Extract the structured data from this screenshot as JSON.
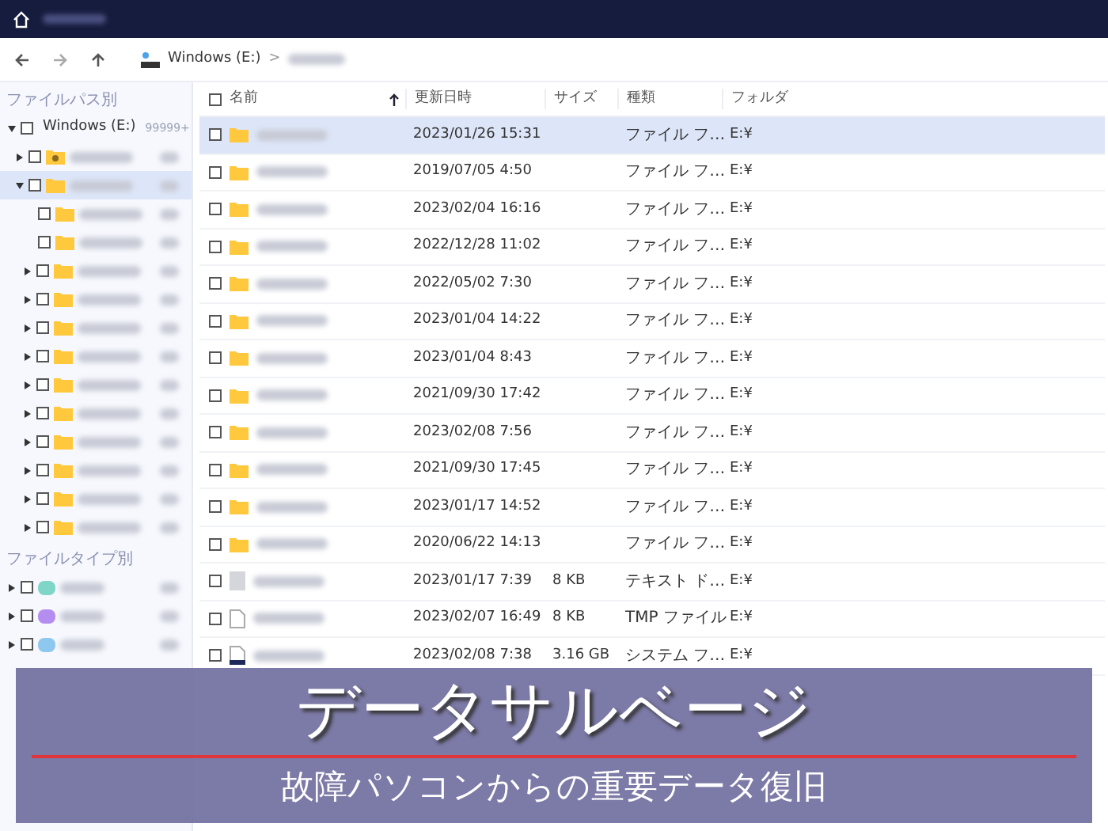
{
  "breadcrumb": {
    "drive": "Windows (E:)",
    "separator": ">"
  },
  "sidebar": {
    "path_heading": "ファイルパス別",
    "tree": [
      {
        "label": "Windows (E:)",
        "count": "99999+",
        "kind": "expanded",
        "selected": false,
        "checked": false,
        "children": [
          {
            "kind": "collapsed",
            "selected": false,
            "checked": false
          },
          {
            "kind": "expanded",
            "selected": true,
            "checked": false,
            "children": [
              {
                "kind": "leaf",
                "selected": false,
                "checked": false
              },
              {
                "kind": "leaf",
                "selected": false,
                "checked": false
              },
              {
                "kind": "collapsed",
                "selected": false,
                "checked": false
              },
              {
                "kind": "collapsed",
                "selected": false,
                "checked": false
              },
              {
                "kind": "collapsed",
                "selected": false,
                "checked": false
              },
              {
                "kind": "collapsed",
                "selected": false,
                "checked": false
              },
              {
                "kind": "collapsed",
                "selected": false,
                "checked": false
              },
              {
                "kind": "collapsed",
                "selected": false,
                "checked": false
              },
              {
                "kind": "collapsed",
                "selected": false,
                "checked": false
              },
              {
                "kind": "collapsed",
                "selected": false,
                "checked": false
              },
              {
                "kind": "collapsed",
                "selected": false,
                "checked": false
              },
              {
                "kind": "collapsed",
                "selected": false,
                "checked": false
              }
            ]
          }
        ]
      }
    ],
    "type_heading": "ファイルタイプ別",
    "types": [
      {
        "color": "#7fd6c8",
        "checked": false
      },
      {
        "color": "#b58cf0",
        "checked": false
      },
      {
        "color": "#8fc8ee",
        "checked": false
      }
    ]
  },
  "table": {
    "header_checked": false,
    "columns": [
      "名前",
      "更新日時",
      "サイズ",
      "種類",
      "フォルダ"
    ],
    "rows": [
      {
        "kind": "folder",
        "date": "2023/01/26 15:31",
        "type": "ファイル フ…",
        "folder": "E:¥",
        "selected": true,
        "checked": false
      },
      {
        "kind": "folder",
        "date": "2019/07/05 4:50",
        "type": "ファイル フ…",
        "folder": "E:¥",
        "selected": false,
        "checked": false
      },
      {
        "kind": "folder",
        "date": "2023/02/04 16:16",
        "type": "ファイル フ…",
        "folder": "E:¥",
        "selected": false,
        "checked": false
      },
      {
        "kind": "folder",
        "date": "2022/12/28 11:02",
        "type": "ファイル フ…",
        "folder": "E:¥",
        "selected": false,
        "checked": false
      },
      {
        "kind": "folder",
        "date": "2022/05/02 7:30",
        "type": "ファイル フ…",
        "folder": "E:¥",
        "selected": false,
        "checked": false
      },
      {
        "kind": "folder",
        "date": "2023/01/04 14:22",
        "type": "ファイル フ…",
        "folder": "E:¥",
        "selected": false,
        "checked": false
      },
      {
        "kind": "folder",
        "date": "2023/01/04 8:43",
        "type": "ファイル フ…",
        "folder": "E:¥",
        "selected": false,
        "checked": false
      },
      {
        "kind": "folder",
        "date": "2021/09/30 17:42",
        "type": "ファイル フ…",
        "folder": "E:¥",
        "selected": false,
        "checked": false
      },
      {
        "kind": "folder",
        "date": "2023/02/08 7:56",
        "type": "ファイル フ…",
        "folder": "E:¥",
        "selected": false,
        "checked": false
      },
      {
        "kind": "folder",
        "date": "2021/09/30 17:45",
        "type": "ファイル フ…",
        "folder": "E:¥",
        "selected": false,
        "checked": false
      },
      {
        "kind": "folder",
        "date": "2023/01/17 14:52",
        "type": "ファイル フ…",
        "folder": "E:¥",
        "selected": false,
        "checked": false
      },
      {
        "kind": "folder",
        "date": "2020/06/22 14:13",
        "type": "ファイル フ…",
        "folder": "E:¥",
        "selected": false,
        "checked": false
      },
      {
        "kind": "text",
        "date": "2023/01/17 7:39",
        "size": "8 KB",
        "type": "テキスト ド…",
        "folder": "E:¥",
        "selected": false,
        "checked": false
      },
      {
        "kind": "blank",
        "date": "2023/02/07 16:49",
        "size": "8 KB",
        "type": "TMP ファイル",
        "folder": "E:¥",
        "selected": false,
        "checked": false
      },
      {
        "kind": "system",
        "date": "2023/02/08 7:38",
        "size": "3.16 GB",
        "type": "システム フ…",
        "folder": "E:¥",
        "selected": false,
        "checked": false
      }
    ]
  },
  "banner": {
    "title": "データサルベージ",
    "subtitle": "故障パソコンからの重要データ復旧"
  }
}
